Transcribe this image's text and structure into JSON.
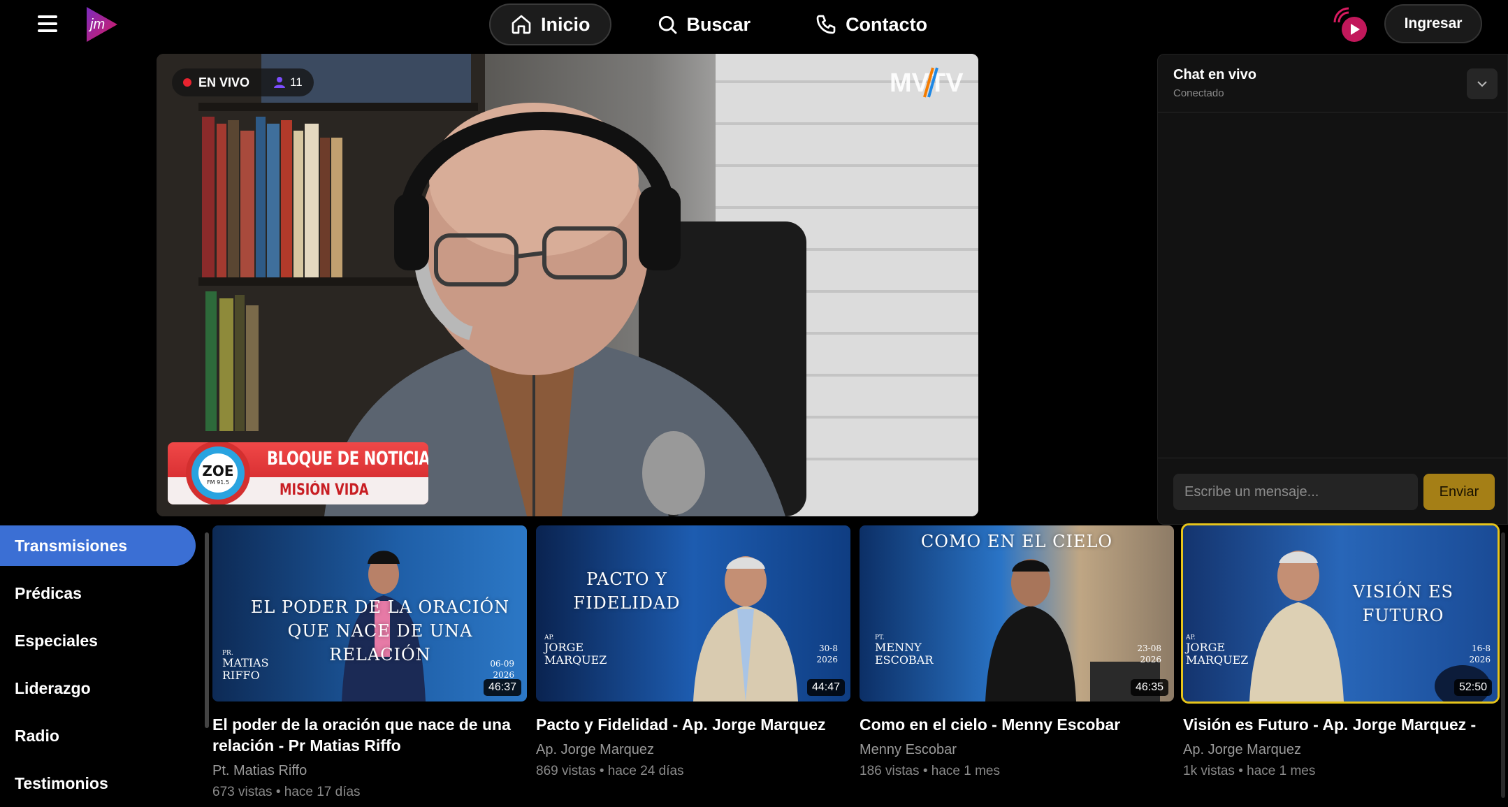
{
  "header": {
    "menu_icon": "hamburger-icon",
    "logo_text": "jm",
    "nav": [
      {
        "label": "Inicio",
        "icon": "home-icon",
        "active": true
      },
      {
        "label": "Buscar",
        "icon": "search-icon",
        "active": false
      },
      {
        "label": "Contacto",
        "icon": "phone-icon",
        "active": false
      }
    ],
    "radio_icon": "radio-broadcast-icon",
    "login_label": "Ingresar"
  },
  "player": {
    "live_label": "EN VIVO",
    "viewer_count": "11",
    "channel_watermark": "MVTV",
    "banner_logo_text": "ZOE",
    "banner_logo_freq": "FM 91.5",
    "banner_title": "BLOQUE DE NOTICIAS",
    "banner_subtitle": "MISIÓN VIDA"
  },
  "chat": {
    "title": "Chat en vivo",
    "status": "Conectado",
    "input_placeholder": "Escribe un mensaje...",
    "send_label": "Enviar"
  },
  "sidebar": {
    "items": [
      {
        "label": "Transmisiones",
        "active": true
      },
      {
        "label": "Prédicas",
        "active": false
      },
      {
        "label": "Especiales",
        "active": false
      },
      {
        "label": "Liderazgo",
        "active": false
      },
      {
        "label": "Radio",
        "active": false
      },
      {
        "label": "Testimonios",
        "active": false
      }
    ]
  },
  "videos": [
    {
      "title": "El poder de la oración que nace de una relación - Pr Matias Riffo",
      "channel": "Pt. Matias Riffo",
      "meta": "673 vistas • hace 17 días",
      "duration": "46:37",
      "thumb_caption_1": "EL PODER DE LA ORACIÓN",
      "thumb_caption_2": "QUE NACE DE UNA RELACIÓN",
      "thumb_prefix": "PR.",
      "thumb_person_1": "MATIAS",
      "thumb_person_2": "RIFFO",
      "thumb_date_1": "06-09",
      "thumb_date_2": "2026"
    },
    {
      "title": "Pacto y Fidelidad - Ap. Jorge Marquez",
      "channel": "Ap. Jorge Marquez",
      "meta": "869 vistas • hace 24 días",
      "duration": "44:47",
      "thumb_caption_1": "PACTO Y FIDELIDAD",
      "thumb_prefix": "AP.",
      "thumb_person_1": "JORGE",
      "thumb_person_2": "MARQUEZ",
      "thumb_date_1": "30-8",
      "thumb_date_2": "2026"
    },
    {
      "title": "Como en el cielo - Menny Escobar",
      "channel": "Menny Escobar",
      "meta": "186 vistas • hace 1 mes",
      "duration": "46:35",
      "thumb_caption_1": "COMO EN EL CIELO",
      "thumb_prefix": "PT.",
      "thumb_person_1": "MENNY",
      "thumb_person_2": "ESCOBAR",
      "thumb_date_1": "23-08",
      "thumb_date_2": "2026"
    },
    {
      "title": "Visión es Futuro - Ap. Jorge Marquez -",
      "channel": "Ap. Jorge Marquez",
      "meta": "1k vistas • hace 1 mes",
      "duration": "52:50",
      "thumb_caption_1": "VISIÓN ES FUTURO",
      "thumb_prefix": "AP.",
      "thumb_person_1": "JORGE",
      "thumb_person_2": "MARQUEZ",
      "thumb_date_1": "16-8",
      "thumb_date_2": "2026"
    }
  ],
  "colors": {
    "accent_blue": "#3b6fd4",
    "live_red": "#e8232f",
    "send_gold": "#a57f16",
    "selected_outline": "#e6c41b",
    "brand_magenta": "#c2185b"
  }
}
